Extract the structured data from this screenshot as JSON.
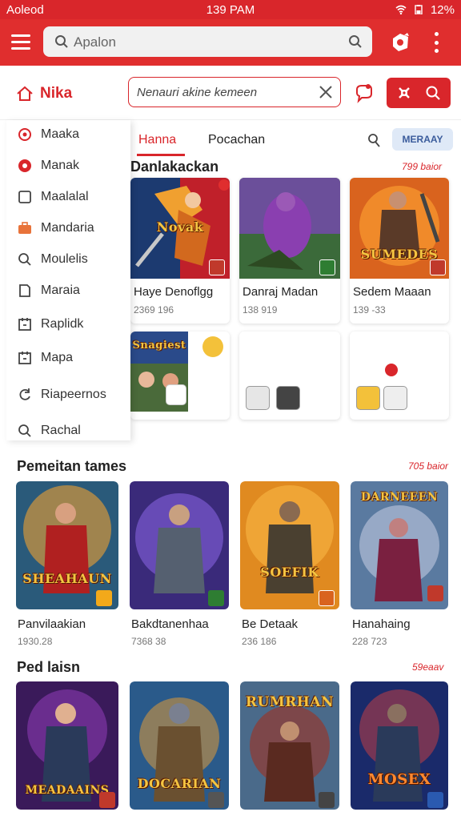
{
  "status_bar": {
    "carrier": "Aoleod",
    "time": "139 PAM",
    "battery": "12%"
  },
  "app_bar": {
    "search_placeholder": "Apalon"
  },
  "sub_header": {
    "home_label": "Nika",
    "search_value": "Nenauri akine kemeen"
  },
  "drawer": {
    "items": [
      {
        "label": "Maaka",
        "icon": "target-icon"
      },
      {
        "label": "Manak",
        "icon": "gear-icon"
      },
      {
        "label": "Maalalal",
        "icon": "square-icon"
      },
      {
        "label": "Mandaria",
        "icon": "briefcase-icon"
      },
      {
        "label": "Moulelis",
        "icon": "search-icon"
      },
      {
        "label": "Maraia",
        "icon": "page-icon"
      },
      {
        "label": "Raplidk",
        "icon": "calendar-icon"
      },
      {
        "label": "Mapa",
        "icon": "calendar-icon"
      },
      {
        "label": "Riapeernos",
        "icon": "refresh-icon"
      },
      {
        "label": "Rachal",
        "icon": "search-icon"
      }
    ]
  },
  "tabs": {
    "active": "Hanna",
    "second": "Pocachan",
    "pill": "MERAAY"
  },
  "section1": {
    "title": "Danlakackan",
    "more": "799 baior",
    "cards": [
      {
        "title": "Haye Denoflgg",
        "meta": "2369 196",
        "art": "Novak"
      },
      {
        "title": "Danraj Madan",
        "meta": "138 919"
      },
      {
        "title": "Sedem Maaan",
        "meta": "139 -33",
        "art": "SUMEDES"
      }
    ],
    "row2_art": "Snagiest"
  },
  "section2": {
    "title": "Pemeitan tames",
    "more": "705 baior",
    "cards": [
      {
        "title": "Panvilaakian",
        "meta": "1930.28",
        "art": "SHEAHAUN"
      },
      {
        "title": "Bakdtanenhaa",
        "meta": "7368 38"
      },
      {
        "title": "Be Detaak",
        "meta": "236 186",
        "art": "SOEFIK"
      },
      {
        "title": "Hanahaing",
        "meta": "228 723",
        "art": "DARNEEEN"
      }
    ]
  },
  "section3": {
    "title": "Ped laisn",
    "more": "59eaav",
    "cards": [
      {
        "art": "MEADAAINS"
      },
      {
        "art": "DOCARIAN"
      },
      {
        "art": "RUMRHAN"
      },
      {
        "art": "MOSEX"
      }
    ]
  },
  "colors": {
    "brand": "#d9262b",
    "surface": "#ffffff"
  }
}
